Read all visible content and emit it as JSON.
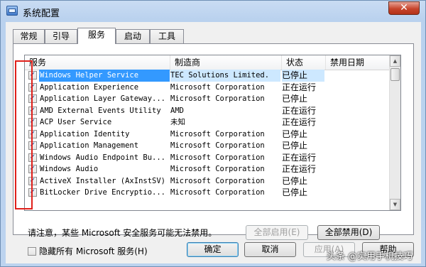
{
  "window": {
    "title": "系统配置",
    "close_symbol": "✕"
  },
  "tabs": [
    {
      "label": "常规",
      "active": false
    },
    {
      "label": "引导",
      "active": false
    },
    {
      "label": "服务",
      "active": true
    },
    {
      "label": "启动",
      "active": false
    },
    {
      "label": "工具",
      "active": false
    }
  ],
  "columns": {
    "service": "服务",
    "manufacturer": "制造商",
    "status": "状态",
    "disabled_date": "禁用日期"
  },
  "rows": [
    {
      "checked": true,
      "name": "Windows Helper Service",
      "manufacturer": "TEC Solutions Limited.",
      "status": "已停止",
      "selected": true
    },
    {
      "checked": true,
      "name": "Application Experience",
      "manufacturer": "Microsoft Corporation",
      "status": "正在运行"
    },
    {
      "checked": true,
      "name": "Application Layer Gateway...",
      "manufacturer": "Microsoft Corporation",
      "status": "已停止"
    },
    {
      "checked": true,
      "name": "AMD External Events Utility",
      "manufacturer": "AMD",
      "status": "正在运行"
    },
    {
      "checked": true,
      "name": "ACP User Service",
      "manufacturer": "未知",
      "status": "正在运行"
    },
    {
      "checked": true,
      "name": "Application Identity",
      "manufacturer": "Microsoft Corporation",
      "status": "已停止"
    },
    {
      "checked": true,
      "name": "Application Management",
      "manufacturer": "Microsoft Corporation",
      "status": "已停止"
    },
    {
      "checked": true,
      "name": "Windows Audio Endpoint Bu...",
      "manufacturer": "Microsoft Corporation",
      "status": "正在运行"
    },
    {
      "checked": true,
      "name": "Windows Audio",
      "manufacturer": "Microsoft Corporation",
      "status": "正在运行"
    },
    {
      "checked": true,
      "name": "ActiveX Installer (AxInstSV)",
      "manufacturer": "Microsoft Corporation",
      "status": "已停止"
    },
    {
      "checked": true,
      "name": "BitLocker Drive Encryptio...",
      "manufacturer": "Microsoft Corporation",
      "status": "已停止"
    }
  ],
  "note": "请注意，某些 Microsoft 安全服务可能无法禁用。",
  "buttons": {
    "enable_all": "全部启用(E)",
    "disable_all": "全部禁用(D)",
    "ok": "确定",
    "cancel": "取消",
    "apply": "应用(A)",
    "help": "帮助"
  },
  "hide_ms": {
    "label": "隐藏所有 Microsoft 服务(H)",
    "checked": false
  },
  "watermark": "头条 @实用手机技巧",
  "colors": {
    "highlight": "#e0201b",
    "selection": "#3399ff"
  }
}
